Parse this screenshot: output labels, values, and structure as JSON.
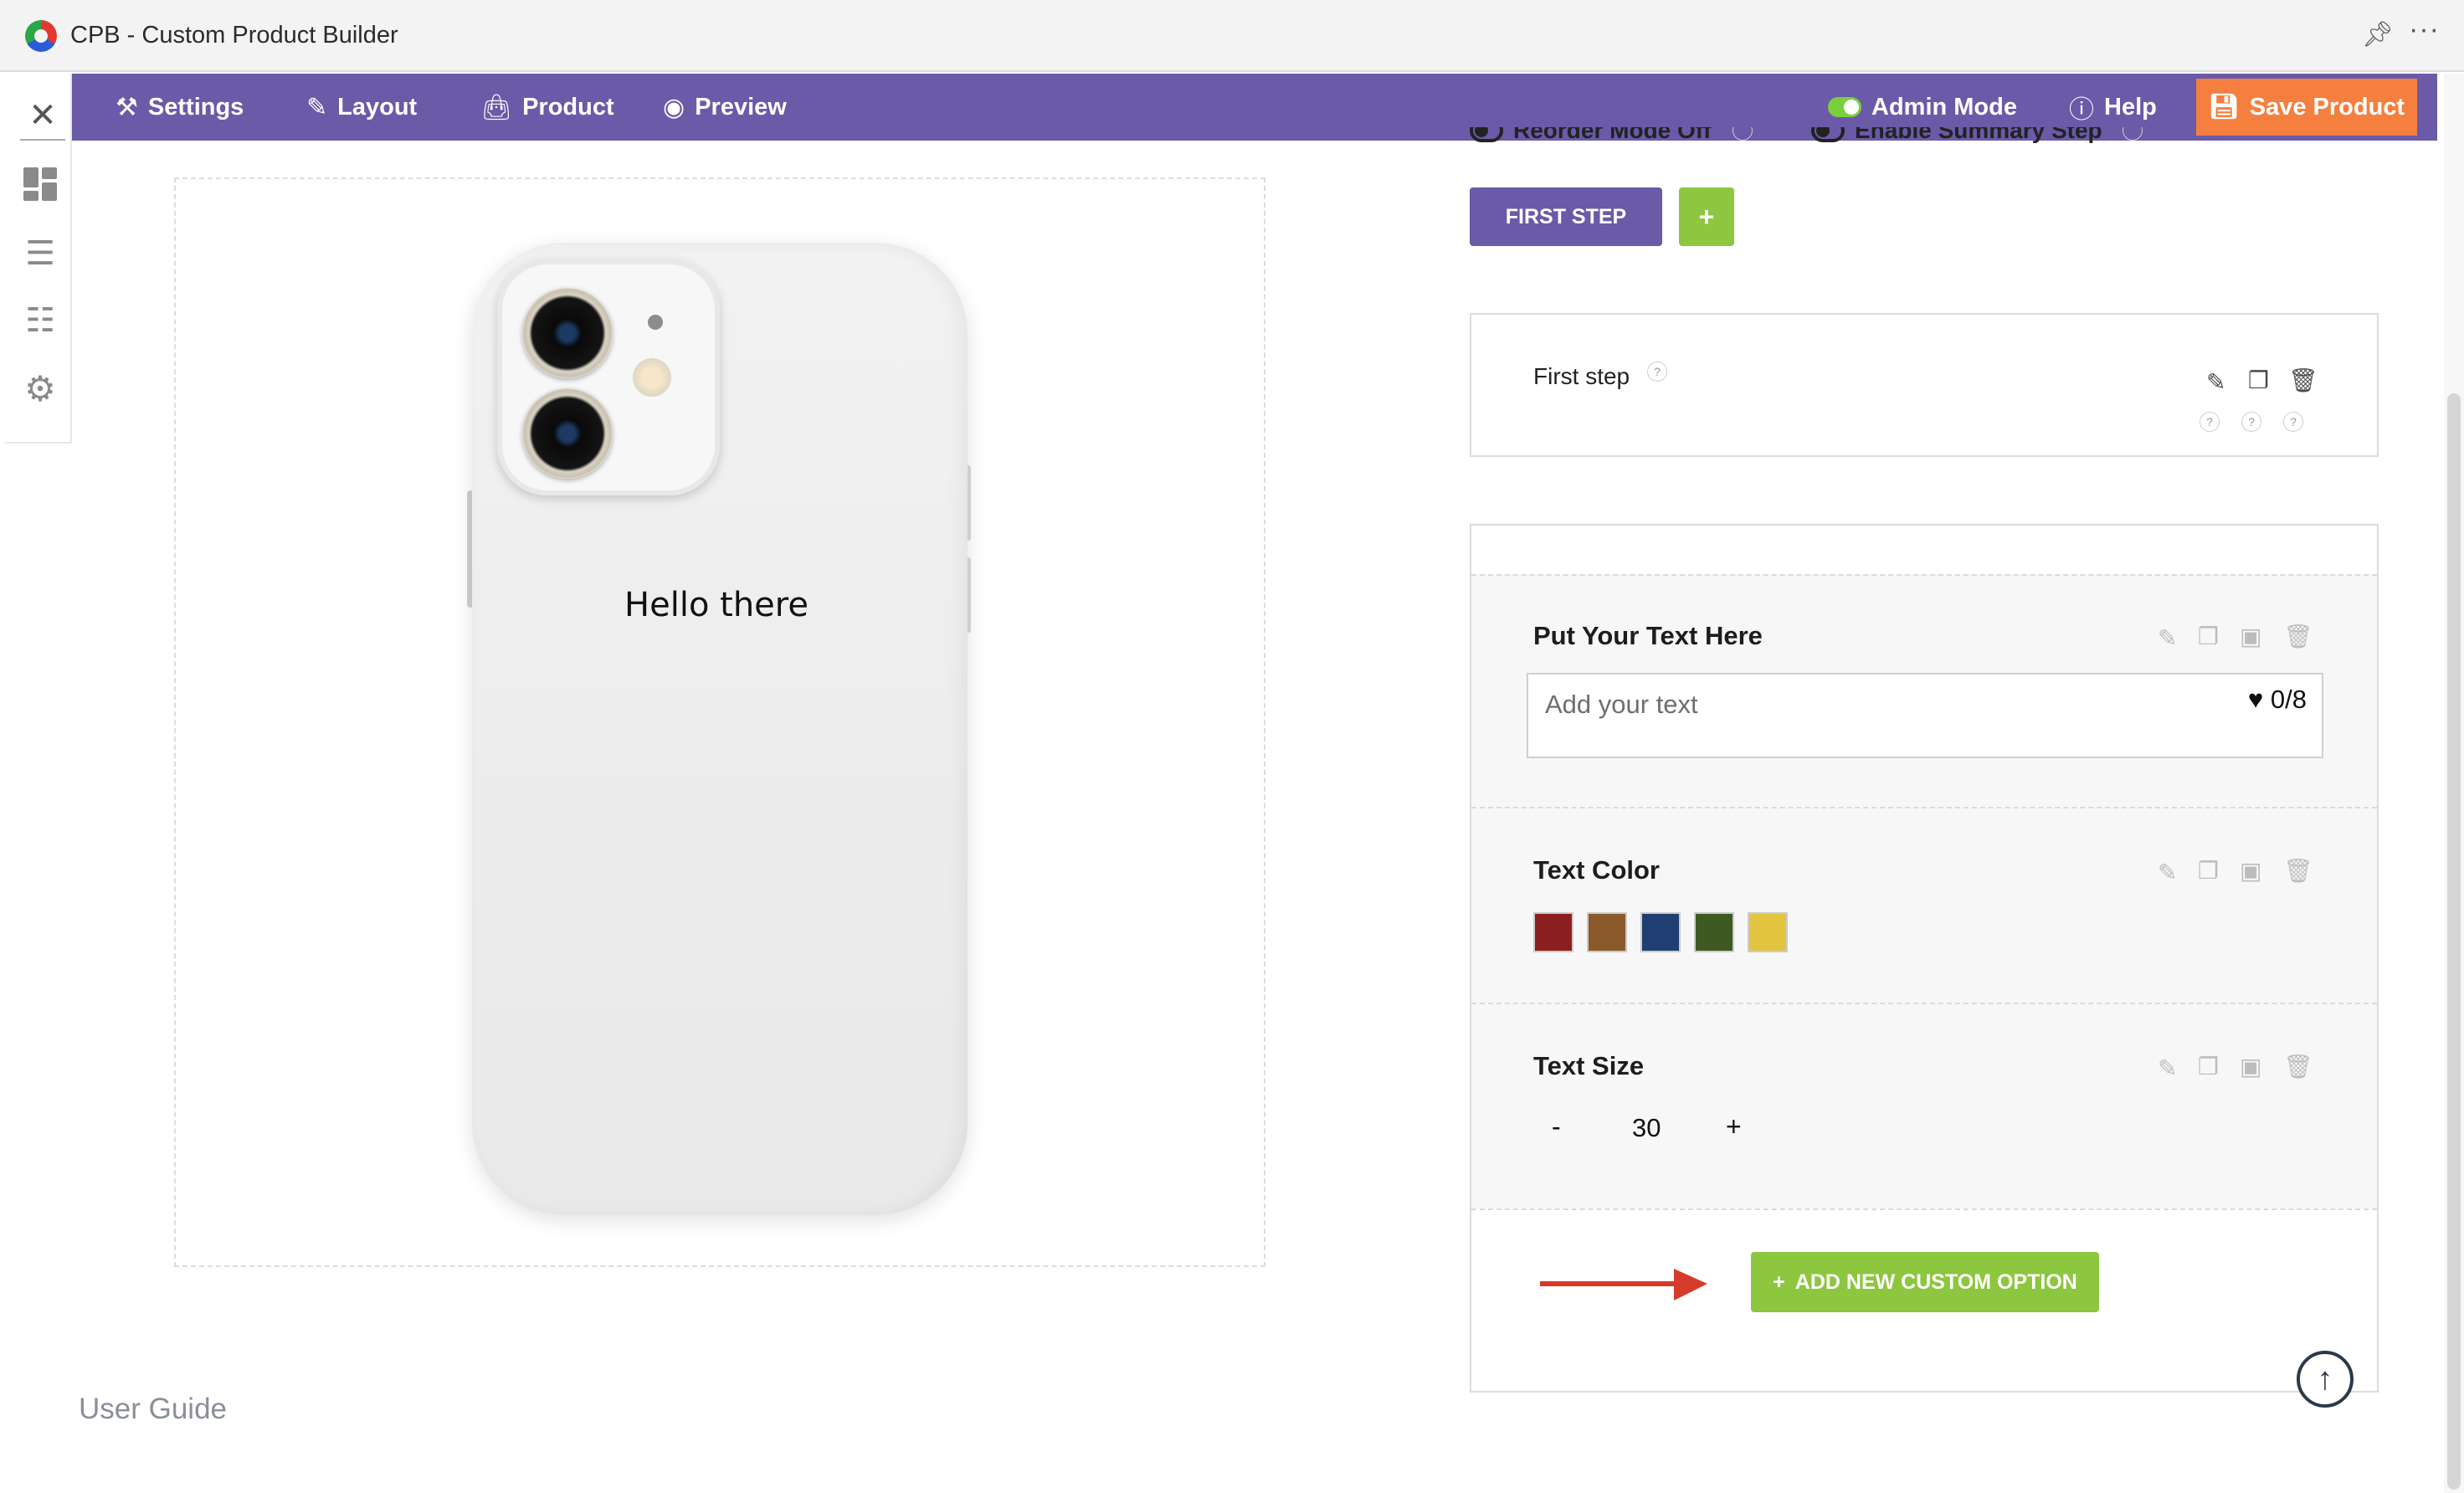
{
  "window": {
    "title": "CPB - Custom Product Builder"
  },
  "navbar": {
    "items": [
      {
        "label": "Settings",
        "icon": "tools-icon"
      },
      {
        "label": "Layout",
        "icon": "brush-icon"
      },
      {
        "label": "Product",
        "icon": "bag-icon"
      },
      {
        "label": "Preview",
        "icon": "eye-icon"
      }
    ],
    "admin_mode_label": "Admin Mode",
    "help_label": "Help",
    "save_label": "Save Product"
  },
  "preview": {
    "engraved_text": "Hello there"
  },
  "footer": {
    "user_guide": "User Guide"
  },
  "steps": {
    "toggles": [
      "Reorder Mode Off",
      "Enable Summary Step"
    ],
    "tab_label": "FIRST STEP",
    "add_label": "+",
    "card_title": "First step"
  },
  "options": {
    "text_field": {
      "title": "Put Your Text Here",
      "placeholder": "Add your text",
      "counter": "0/8"
    },
    "text_color": {
      "title": "Text Color",
      "swatches": [
        "#8b1f1f",
        "#8a5a2b",
        "#1f3f73",
        "#3e5a22",
        "#e3c440"
      ]
    },
    "text_size": {
      "title": "Text Size",
      "minus": "-",
      "value": "30",
      "plus": "+"
    },
    "add_button": "ADD NEW CUSTOM OPTION"
  },
  "colors": {
    "brand_purple": "#6a5aa8",
    "save_orange": "#f47f3e",
    "accent_green": "#8dc63f"
  }
}
